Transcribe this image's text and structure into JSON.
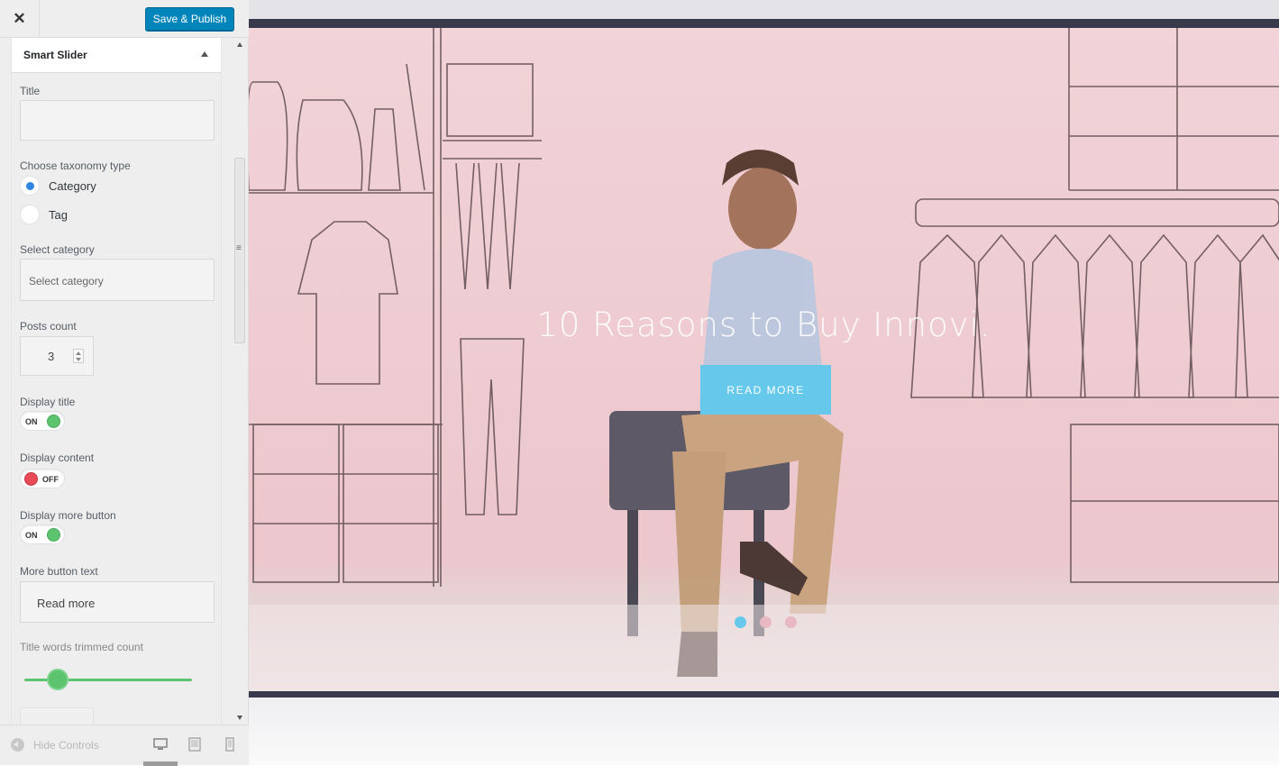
{
  "header": {
    "close_icon": "close-icon",
    "publish_label": "Save & Publish"
  },
  "section": {
    "title": "Smart Slider"
  },
  "controls": {
    "title_label": "Title",
    "title_value": "",
    "taxonomy_label": "Choose taxonomy type",
    "taxonomy_options": [
      {
        "label": "Category",
        "checked": true
      },
      {
        "label": "Tag",
        "checked": false
      }
    ],
    "category_label": "Select category",
    "category_placeholder": "Select category",
    "posts_count_label": "Posts count",
    "posts_count_value": "3",
    "display_title_label": "Display title",
    "display_title_state": "ON",
    "display_content_label": "Display content",
    "display_content_state": "OFF",
    "display_more_label": "Display more button",
    "display_more_state": "ON",
    "more_text_label": "More button text",
    "more_text_value": "Read more",
    "trim_label": "Title words trimmed count",
    "trim_slider_fraction": 0.2
  },
  "footer": {
    "hide_controls": "Hide Controls",
    "devices": [
      "desktop-icon",
      "tablet-icon",
      "mobile-icon"
    ],
    "active_device": "desktop"
  },
  "preview": {
    "slide_title": "10 Reasons to Buy Innovi.",
    "button_label": "READ MORE",
    "dots_count": 3,
    "active_dot": 0,
    "colors": {
      "button": "#66c9ec",
      "slide_bg": "#ecc7cd",
      "frame": "#39394d"
    }
  }
}
